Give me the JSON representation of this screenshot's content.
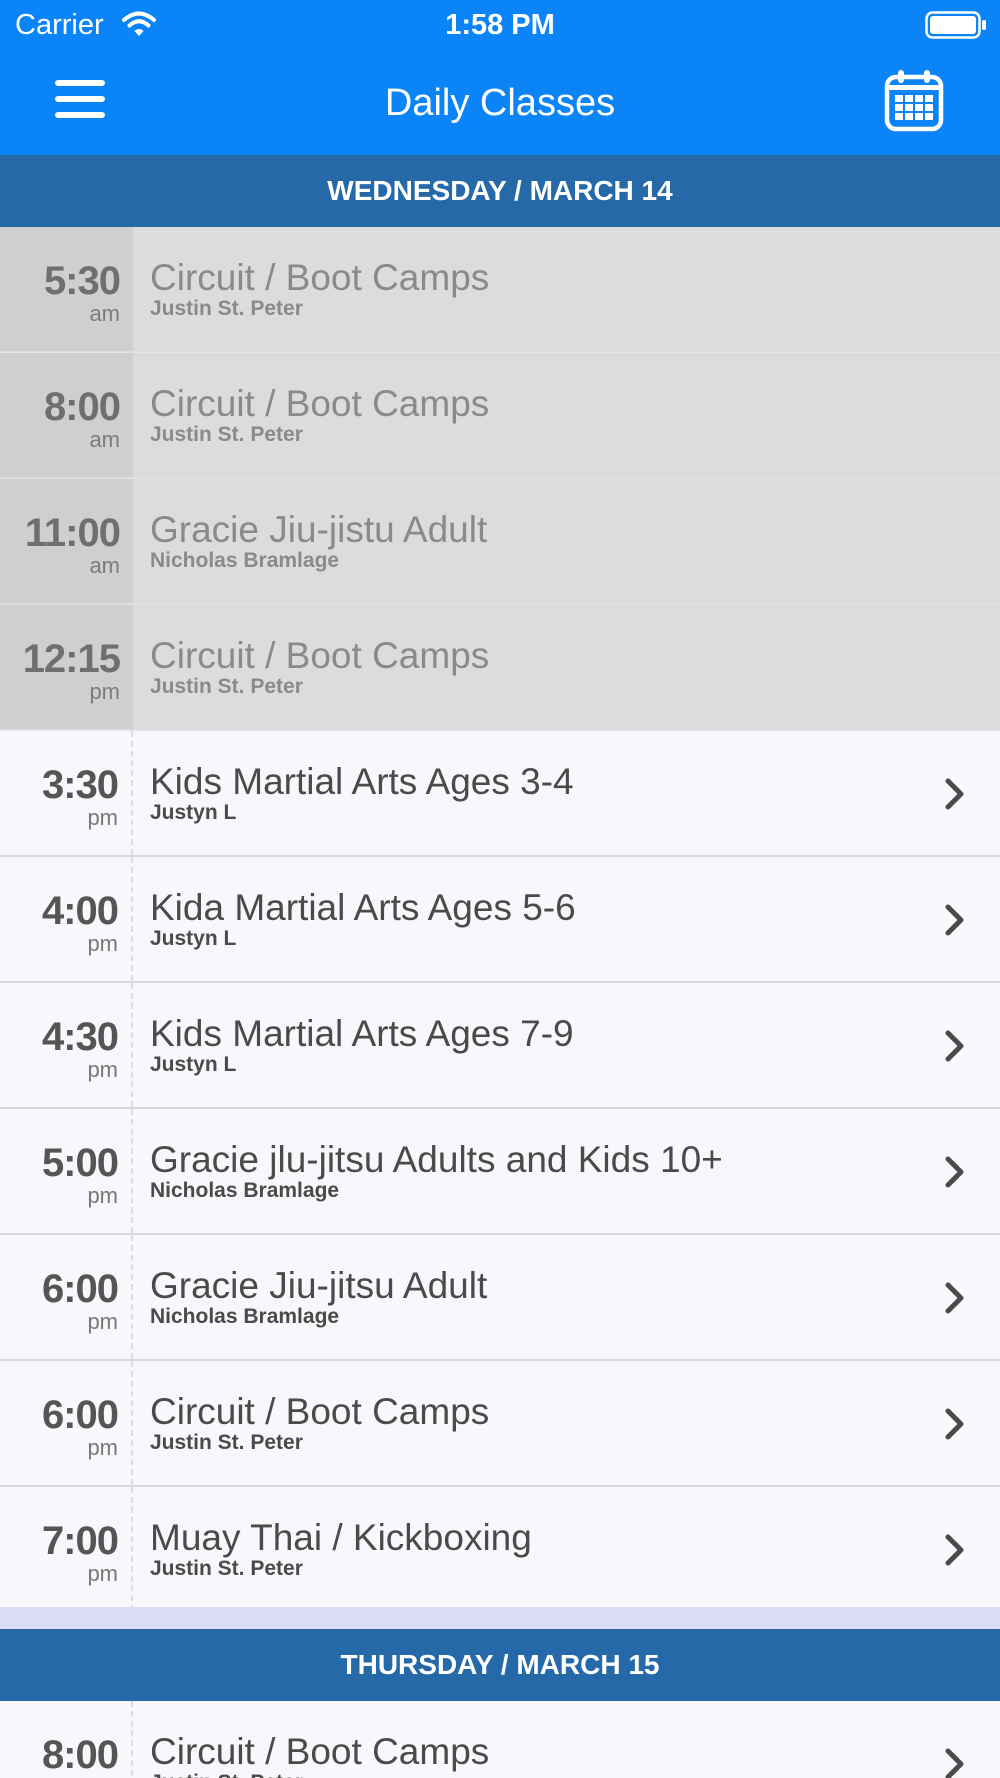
{
  "status_bar": {
    "carrier": "Carrier",
    "time": "1:58 PM"
  },
  "nav": {
    "title": "Daily Classes",
    "menu_icon": "hamburger-icon",
    "calendar_icon": "calendar-icon"
  },
  "colors": {
    "header_bg": "#0a84f7",
    "day_header_bg": "#2569a8",
    "past_row_bg": "#dcdcde"
  },
  "days": [
    {
      "label": "WEDNESDAY / MARCH 14",
      "classes": [
        {
          "time": "5:30",
          "ampm": "am",
          "title": "Circuit / Boot Camps",
          "instructor": "Justin St. Peter",
          "past": true
        },
        {
          "time": "8:00",
          "ampm": "am",
          "title": "Circuit / Boot Camps",
          "instructor": "Justin St. Peter",
          "past": true
        },
        {
          "time": "11:00",
          "ampm": "am",
          "title": "Gracie Jiu-jistu Adult",
          "instructor": "Nicholas Bramlage",
          "past": true
        },
        {
          "time": "12:15",
          "ampm": "pm",
          "title": "Circuit / Boot Camps",
          "instructor": "Justin St. Peter",
          "past": true
        },
        {
          "time": "3:30",
          "ampm": "pm",
          "title": "Kids Martial Arts Ages 3-4",
          "instructor": "Justyn L",
          "past": false
        },
        {
          "time": "4:00",
          "ampm": "pm",
          "title": "Kida Martial Arts Ages 5-6",
          "instructor": "Justyn L",
          "past": false
        },
        {
          "time": "4:30",
          "ampm": "pm",
          "title": "Kids Martial Arts Ages 7-9",
          "instructor": "Justyn L",
          "past": false
        },
        {
          "time": "5:00",
          "ampm": "pm",
          "title": "Gracie jlu-jitsu Adults and Kids 10+",
          "instructor": "Nicholas Bramlage",
          "past": false
        },
        {
          "time": "6:00",
          "ampm": "pm",
          "title": "Gracie Jiu-jitsu Adult",
          "instructor": "Nicholas Bramlage",
          "past": false
        },
        {
          "time": "6:00",
          "ampm": "pm",
          "title": "Circuit / Boot Camps",
          "instructor": "Justin St. Peter",
          "past": false
        },
        {
          "time": "7:00",
          "ampm": "pm",
          "title": "Muay Thai / Kickboxing",
          "instructor": "Justin St. Peter",
          "past": false
        }
      ]
    },
    {
      "label": "THURSDAY / MARCH 15",
      "classes": [
        {
          "time": "8:00",
          "ampm": "",
          "title": "Circuit / Boot Camps",
          "instructor": "Justin St. Peter",
          "past": false
        }
      ]
    }
  ]
}
